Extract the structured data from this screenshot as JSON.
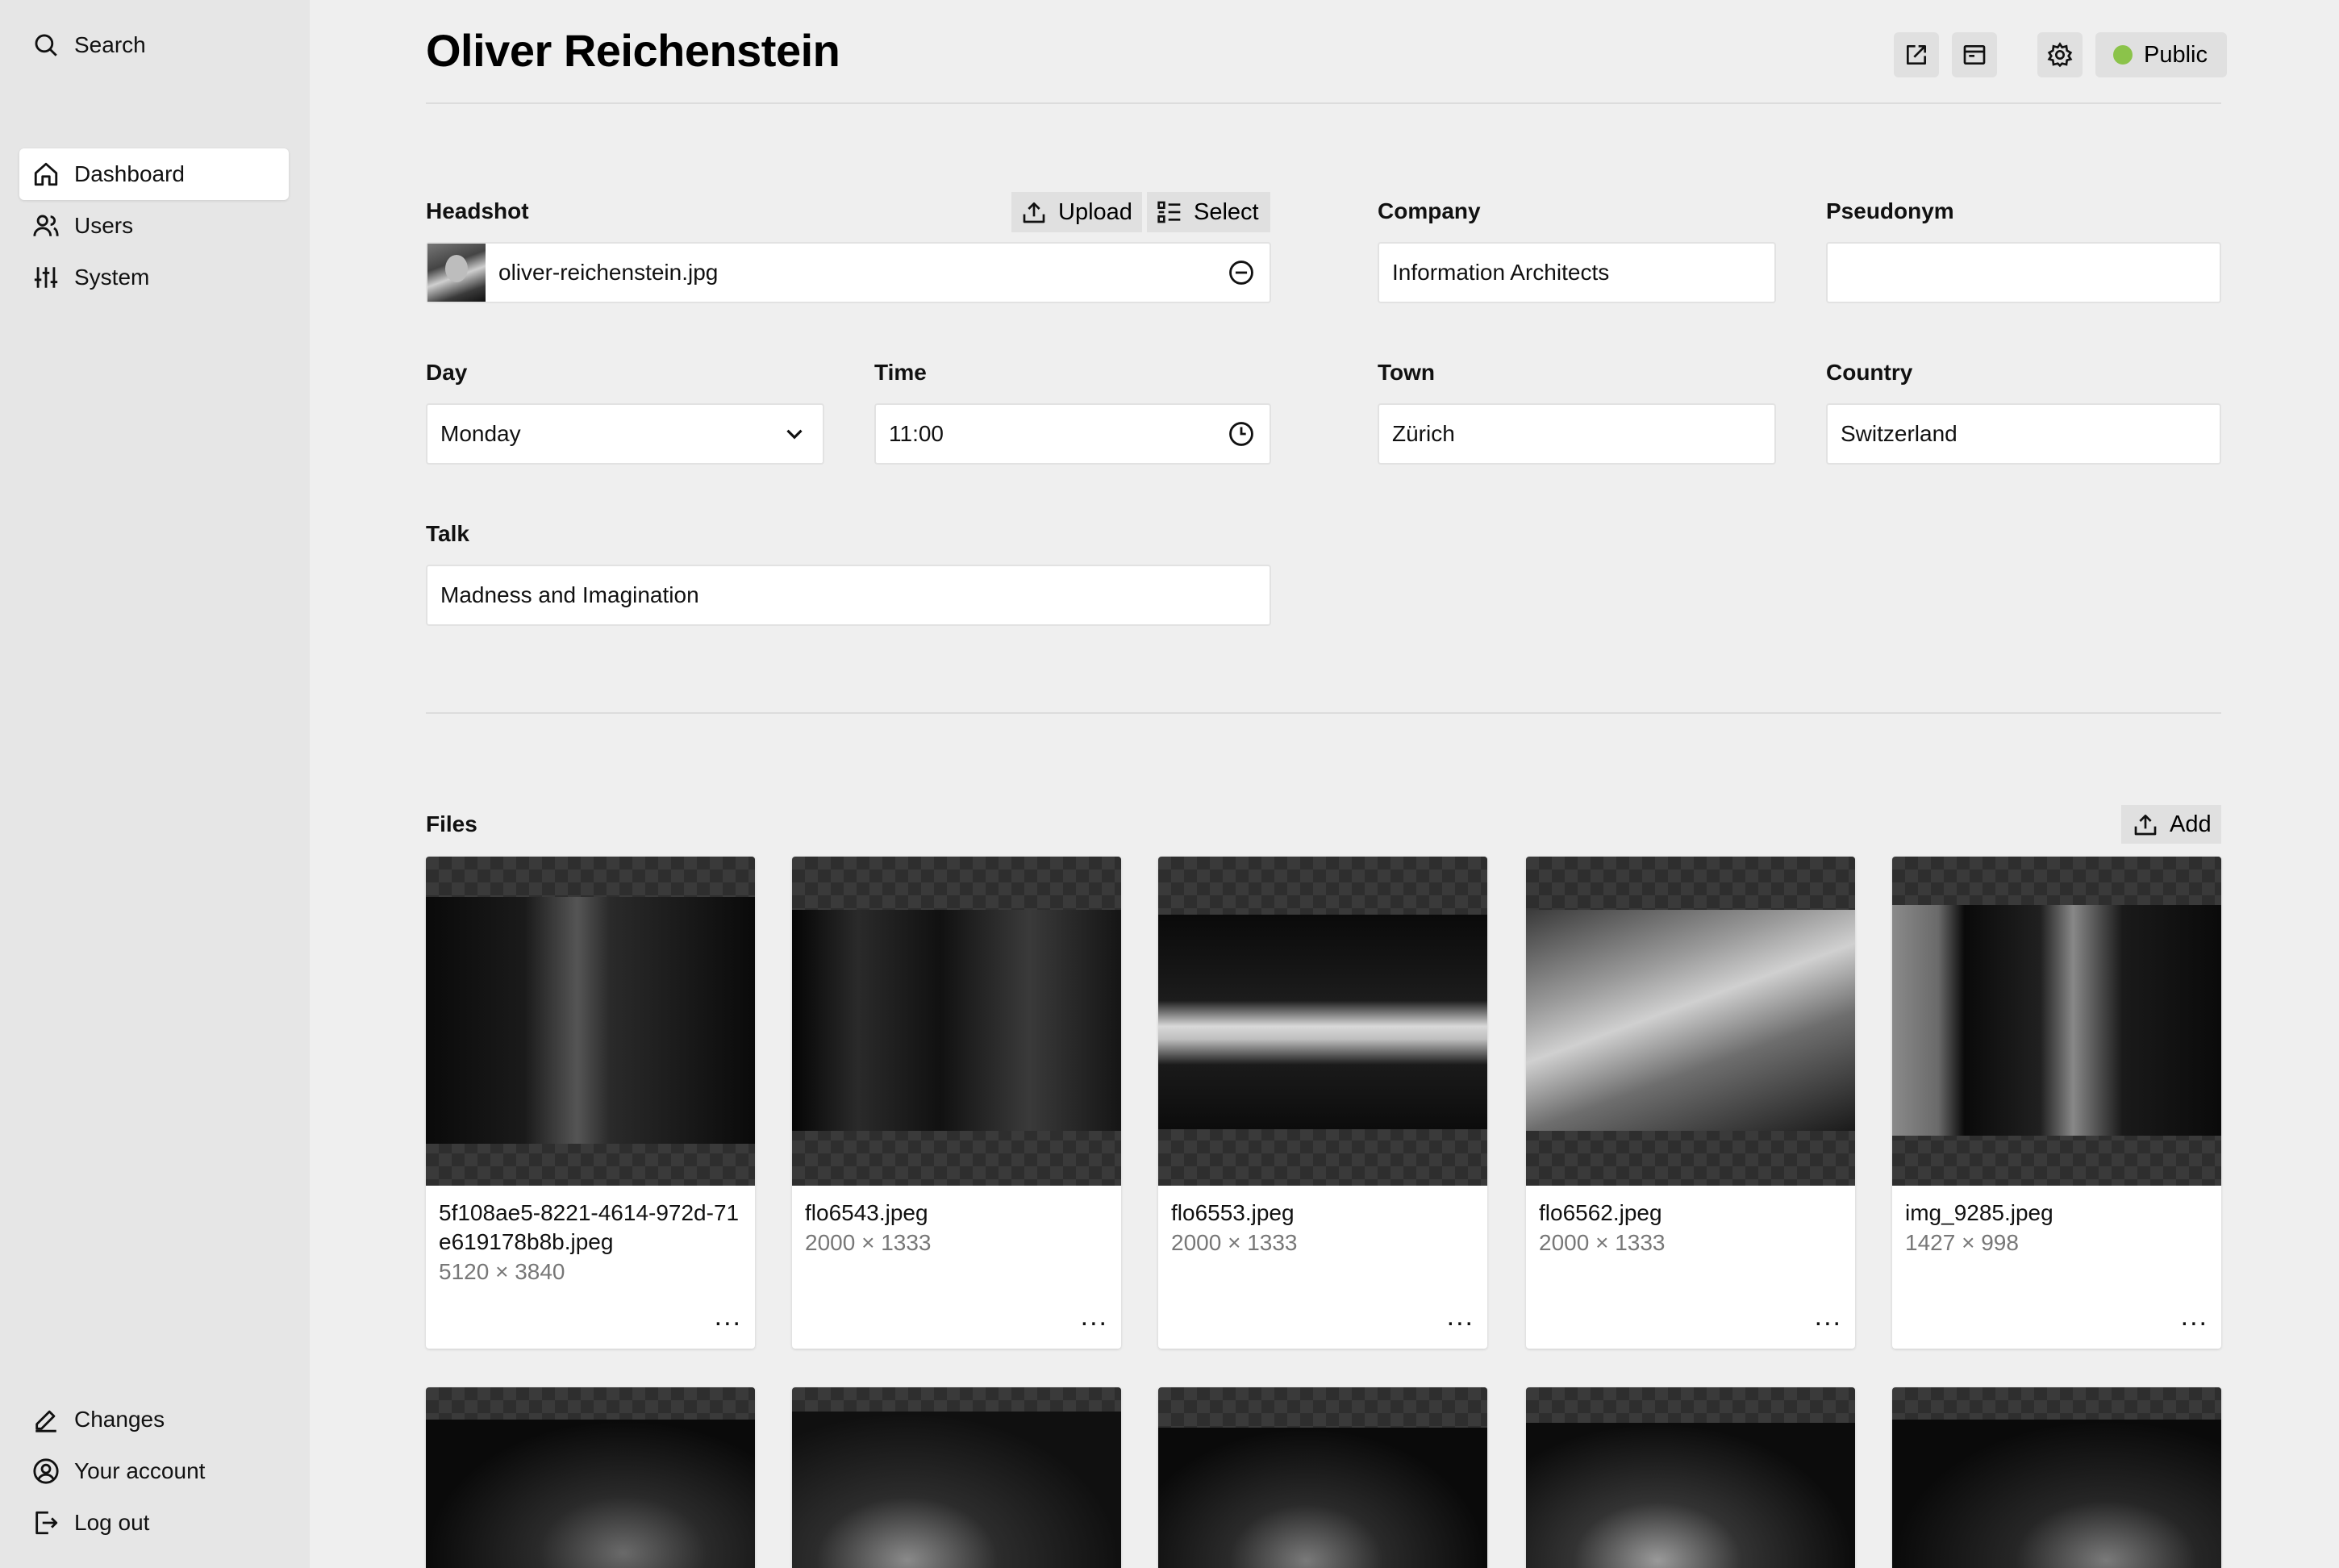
{
  "sidebar": {
    "search": "Search",
    "nav": [
      "Dashboard",
      "Users",
      "System"
    ],
    "bottom": [
      "Changes",
      "Your account",
      "Log out"
    ]
  },
  "header": {
    "title": "Oliver Reichenstein",
    "status_label": "Public",
    "status_color": "#8bc34a"
  },
  "form": {
    "headshot": {
      "label": "Headshot",
      "upload": "Upload",
      "select": "Select",
      "value": "oliver-reichenstein.jpg"
    },
    "company": {
      "label": "Company",
      "value": "Information Architects"
    },
    "pseudonym": {
      "label": "Pseudonym",
      "value": ""
    },
    "day": {
      "label": "Day",
      "value": "Monday"
    },
    "time": {
      "label": "Time",
      "value": "11:00"
    },
    "town": {
      "label": "Town",
      "value": "Zürich"
    },
    "country": {
      "label": "Country",
      "value": "Switzerland"
    },
    "talk": {
      "label": "Talk",
      "value": "Madness and Imagination"
    }
  },
  "files": {
    "label": "Files",
    "add": "Add",
    "items": [
      {
        "name": "5f108ae5-8221-4614-972d-71e619178b8b.jpeg",
        "dims": "5120 × 3840"
      },
      {
        "name": "flo6543.jpeg",
        "dims": "2000 × 1333"
      },
      {
        "name": "flo6553.jpeg",
        "dims": "2000 × 1333"
      },
      {
        "name": "flo6562.jpeg",
        "dims": "2000 × 1333"
      },
      {
        "name": "img_9285.jpeg",
        "dims": "1427 × 998"
      }
    ],
    "more_glyph": "..."
  }
}
